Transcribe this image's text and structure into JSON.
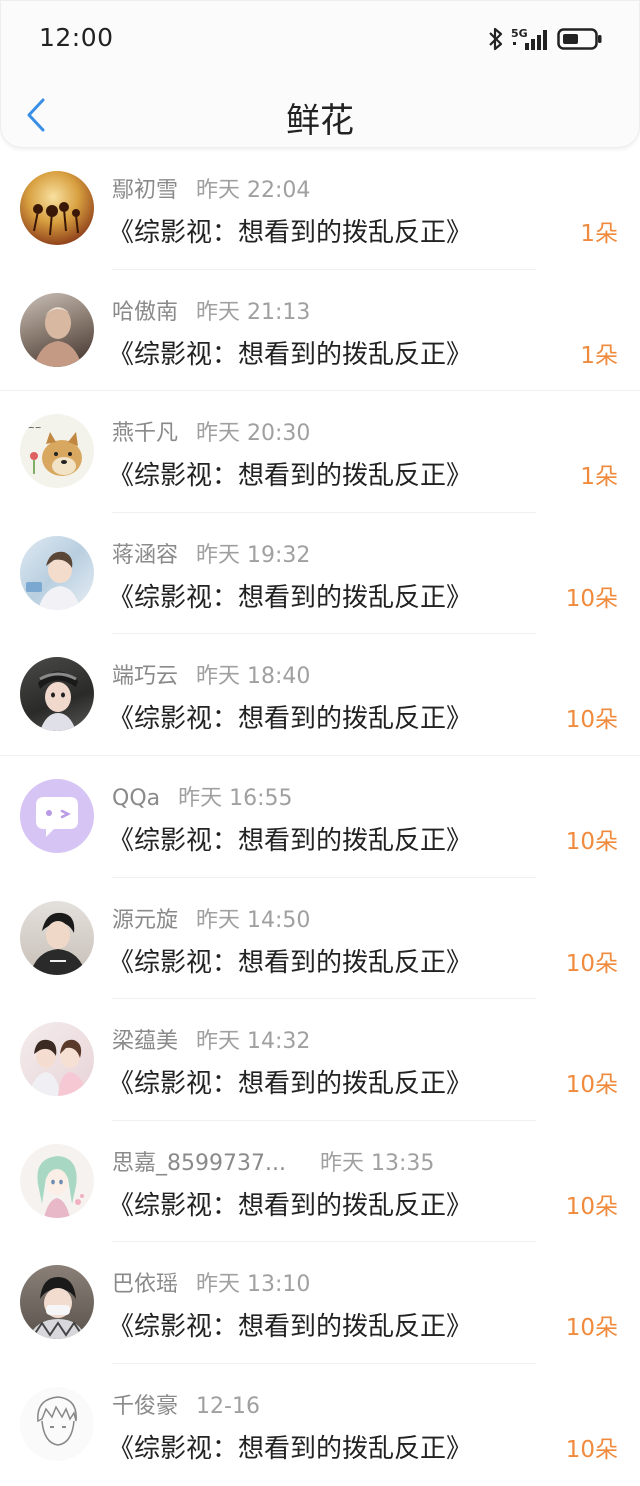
{
  "status_bar": {
    "time": "12:00",
    "network": "5G"
  },
  "nav": {
    "title": "鲜花"
  },
  "items": [
    {
      "name": "鄢初雪",
      "time": "昨天 22:04",
      "work": "《综影视：想看到的拨乱反正》",
      "count": "1朵"
    },
    {
      "name": "哈傲南",
      "time": "昨天 21:13",
      "work": "《综影视：想看到的拨乱反正》",
      "count": "1朵"
    },
    {
      "name": "燕千凡",
      "time": "昨天 20:30",
      "work": "《综影视：想看到的拨乱反正》",
      "count": "1朵"
    },
    {
      "name": "蒋涵容",
      "time": "昨天 19:32",
      "work": "《综影视：想看到的拨乱反正》",
      "count": "10朵"
    },
    {
      "name": "端巧云",
      "time": "昨天 18:40",
      "work": "《综影视：想看到的拨乱反正》",
      "count": "10朵"
    },
    {
      "name": "QQa",
      "time": "昨天 16:55",
      "work": "《综影视：想看到的拨乱反正》",
      "count": "10朵"
    },
    {
      "name": "源元旋",
      "time": "昨天 14:50",
      "work": "《综影视：想看到的拨乱反正》",
      "count": "10朵"
    },
    {
      "name": "梁蕴美",
      "time": "昨天 14:32",
      "work": "《综影视：想看到的拨乱反正》",
      "count": "10朵"
    },
    {
      "name": "思嘉_8599737...",
      "time": "昨天 13:35",
      "work": "《综影视：想看到的拨乱反正》",
      "count": "10朵"
    },
    {
      "name": "巴依瑶",
      "time": "昨天 13:10",
      "work": "《综影视：想看到的拨乱反正》",
      "count": "10朵"
    },
    {
      "name": "千俊豪",
      "time": "12-16",
      "work": "《综影视：想看到的拨乱反正》",
      "count": "10朵"
    }
  ]
}
